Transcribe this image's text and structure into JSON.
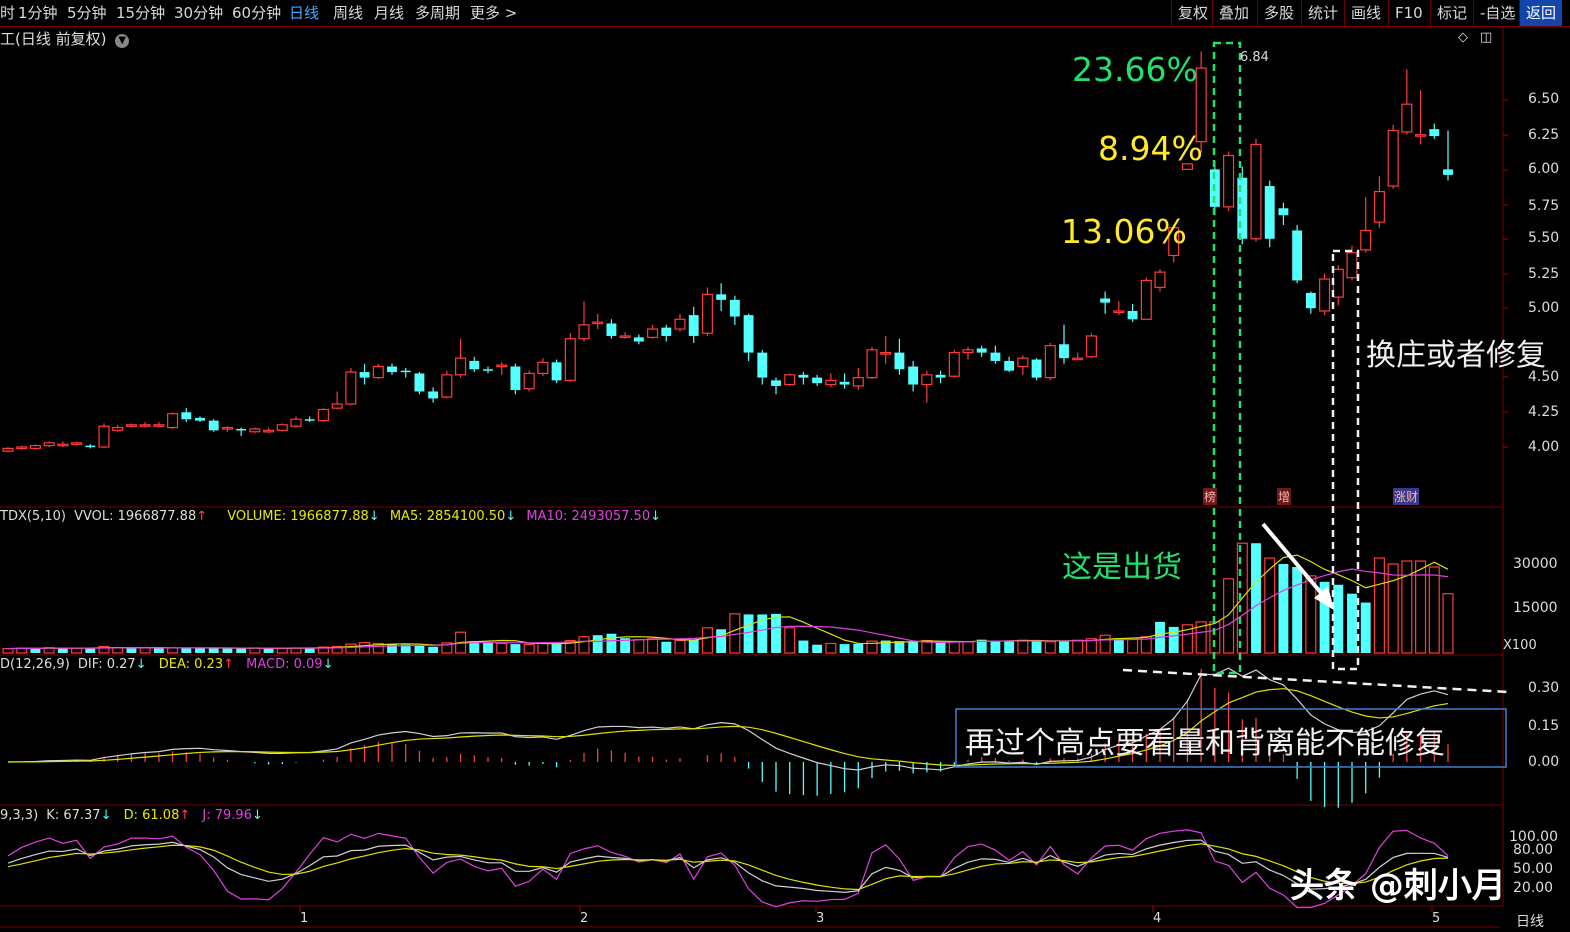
{
  "topbar": {
    "periods": [
      "1分钟",
      "5分钟",
      "15分钟",
      "30分钟",
      "60分钟",
      "日线",
      "周线",
      "月线",
      "多周期",
      "更多 >"
    ],
    "active_period": "日线",
    "tools": [
      "复权",
      "叠加",
      "多股",
      "统计",
      "画线",
      "F10",
      "标记",
      "-自选",
      "返回"
    ]
  },
  "price_panel": {
    "title": "(日线 前复权)",
    "high_label": "6.84",
    "y_ticks": [
      "6.50",
      "6.25",
      "6.00",
      "5.75",
      "5.50",
      "5.25",
      "5.00",
      "4.50",
      "4.25",
      "4.00"
    ],
    "markers": [
      "榜",
      "增",
      "涨财"
    ]
  },
  "volume_panel": {
    "legend": {
      "name": "TDX(5,10)",
      "vvol": "VVOL: 1966877.88",
      "volume": "VOLUME: 1966877.88",
      "ma5": "MA5: 2854100.50",
      "ma10": "MA10: 2493057.50"
    },
    "y_ticks": [
      "30000",
      "15000"
    ],
    "unit": "X100"
  },
  "macd_panel": {
    "legend": {
      "name": "D(12,26,9)",
      "dif": "DIF: 0.27",
      "dea": "DEA: 0.23",
      "macd": "MACD: 0.09"
    },
    "y_ticks": [
      "0.30",
      "0.15",
      "0.00"
    ]
  },
  "kdj_panel": {
    "legend": {
      "name": "9,3,3)",
      "k": "K: 67.37",
      "d": "D: 61.08",
      "j": "J: 79.96"
    },
    "y_ticks": [
      "100.00",
      "80.00",
      "50.00",
      "20.00"
    ]
  },
  "x_axis": {
    "labels": [
      "1",
      "2",
      "3",
      "4",
      "5"
    ],
    "period_label": "日线"
  },
  "annotations": {
    "pct1": "23.66%",
    "pct2": "8.94%",
    "pct3": "13.06%",
    "right_note": "换庄或者修复",
    "volume_note": "这是出货",
    "macd_note": "再过个高点要看量和背离能不能修复",
    "watermark": "头条 @刺小月"
  },
  "colors": {
    "up": "#ff3b3b",
    "down": "#54ffff",
    "ma5": "#e0e000",
    "ma10": "#e040e0",
    "dif": "#d0d0d0",
    "dea": "#e0e000",
    "green_annot": "#22e06b",
    "yellow_annot": "#ffe82a"
  },
  "chart_data": {
    "type": "candlestick",
    "y_range": [
      3.8,
      6.95
    ],
    "candles": [
      [
        3.97,
        3.99,
        3.96,
        4.0
      ],
      [
        3.99,
        4.0,
        3.98,
        4.01
      ],
      [
        3.99,
        4.01,
        3.98,
        4.02
      ],
      [
        4.01,
        4.03,
        4.0,
        4.04
      ],
      [
        4.01,
        4.02,
        4.0,
        4.04
      ],
      [
        4.02,
        4.03,
        4.01,
        4.04
      ],
      [
        4.01,
        4.0,
        3.99,
        4.02
      ],
      [
        4.0,
        4.15,
        3.99,
        4.17
      ],
      [
        4.12,
        4.14,
        4.11,
        4.16
      ],
      [
        4.15,
        4.16,
        4.14,
        4.17
      ],
      [
        4.16,
        4.16,
        4.14,
        4.18
      ],
      [
        4.15,
        4.16,
        4.14,
        4.18
      ],
      [
        4.14,
        4.24,
        4.13,
        4.25
      ],
      [
        4.25,
        4.2,
        4.18,
        4.28
      ],
      [
        4.21,
        4.19,
        4.18,
        4.22
      ],
      [
        4.19,
        4.12,
        4.11,
        4.2
      ],
      [
        4.13,
        4.14,
        4.11,
        4.15
      ],
      [
        4.13,
        4.12,
        4.08,
        4.14
      ],
      [
        4.11,
        4.13,
        4.1,
        4.14
      ],
      [
        4.12,
        4.12,
        4.1,
        4.14
      ],
      [
        4.12,
        4.16,
        4.11,
        4.17
      ],
      [
        4.15,
        4.2,
        4.14,
        4.22
      ],
      [
        4.2,
        4.19,
        4.18,
        4.22
      ],
      [
        4.19,
        4.27,
        4.18,
        4.28
      ],
      [
        4.28,
        4.31,
        4.27,
        4.4
      ],
      [
        4.31,
        4.54,
        4.3,
        4.57
      ],
      [
        4.54,
        4.5,
        4.45,
        4.6
      ],
      [
        4.5,
        4.58,
        4.49,
        4.6
      ],
      [
        4.58,
        4.54,
        4.52,
        4.6
      ],
      [
        4.55,
        4.54,
        4.5,
        4.57
      ],
      [
        4.53,
        4.4,
        4.38,
        4.54
      ],
      [
        4.4,
        4.35,
        4.32,
        4.43
      ],
      [
        4.36,
        4.52,
        4.35,
        4.55
      ],
      [
        4.52,
        4.64,
        4.5,
        4.78
      ],
      [
        4.62,
        4.56,
        4.54,
        4.65
      ],
      [
        4.56,
        4.55,
        4.53,
        4.58
      ],
      [
        4.58,
        4.59,
        4.52,
        4.61
      ],
      [
        4.58,
        4.41,
        4.38,
        4.6
      ],
      [
        4.42,
        4.53,
        4.4,
        4.55
      ],
      [
        4.53,
        4.61,
        4.51,
        4.64
      ],
      [
        4.61,
        4.48,
        4.46,
        4.63
      ],
      [
        4.48,
        4.78,
        4.47,
        4.82
      ],
      [
        4.78,
        4.88,
        4.76,
        5.05
      ],
      [
        4.9,
        4.9,
        4.85,
        4.96
      ],
      [
        4.89,
        4.8,
        4.78,
        4.92
      ],
      [
        4.8,
        4.8,
        4.78,
        4.83
      ],
      [
        4.79,
        4.76,
        4.74,
        4.81
      ],
      [
        4.79,
        4.85,
        4.78,
        4.88
      ],
      [
        4.86,
        4.8,
        4.76,
        4.88
      ],
      [
        4.85,
        4.92,
        4.83,
        4.96
      ],
      [
        4.95,
        4.8,
        4.75,
        5.01
      ],
      [
        4.82,
        5.1,
        4.8,
        5.15
      ],
      [
        5.1,
        5.06,
        4.98,
        5.18
      ],
      [
        5.06,
        4.94,
        4.88,
        5.09
      ],
      [
        4.95,
        4.68,
        4.62,
        4.96
      ],
      [
        4.68,
        4.5,
        4.45,
        4.7
      ],
      [
        4.48,
        4.44,
        4.38,
        4.5
      ],
      [
        4.45,
        4.52,
        4.44,
        4.53
      ],
      [
        4.52,
        4.5,
        4.45,
        4.54
      ],
      [
        4.5,
        4.46,
        4.44,
        4.52
      ],
      [
        4.45,
        4.48,
        4.43,
        4.53
      ],
      [
        4.47,
        4.45,
        4.42,
        4.53
      ],
      [
        4.44,
        4.5,
        4.41,
        4.57
      ],
      [
        4.5,
        4.7,
        4.49,
        4.72
      ],
      [
        4.68,
        4.68,
        4.6,
        4.8
      ],
      [
        4.68,
        4.56,
        4.52,
        4.78
      ],
      [
        4.58,
        4.45,
        4.4,
        4.62
      ],
      [
        4.45,
        4.52,
        4.32,
        4.55
      ],
      [
        4.52,
        4.5,
        4.46,
        4.55
      ],
      [
        4.51,
        4.68,
        4.5,
        4.7
      ],
      [
        4.68,
        4.7,
        4.63,
        4.72
      ],
      [
        4.71,
        4.68,
        4.65,
        4.73
      ],
      [
        4.68,
        4.62,
        4.6,
        4.73
      ],
      [
        4.62,
        4.55,
        4.54,
        4.65
      ],
      [
        4.58,
        4.64,
        4.52,
        4.66
      ],
      [
        4.63,
        4.5,
        4.48,
        4.64
      ],
      [
        4.5,
        4.73,
        4.48,
        4.75
      ],
      [
        4.74,
        4.64,
        4.6,
        4.88
      ],
      [
        4.64,
        4.64,
        4.63,
        4.68
      ],
      [
        4.65,
        4.8,
        4.64,
        4.82
      ],
      [
        5.07,
        5.04,
        4.96,
        5.12
      ],
      [
        4.98,
        4.98,
        4.95,
        5.05
      ],
      [
        4.98,
        4.92,
        4.9,
        5.03
      ],
      [
        4.92,
        5.2,
        4.92,
        5.22
      ],
      [
        5.15,
        5.26,
        5.12,
        5.28
      ],
      [
        5.38,
        5.58,
        5.33,
        5.6
      ],
      [
        6.0,
        6.04,
        6.0,
        6.04
      ],
      [
        6.2,
        6.73,
        6.12,
        6.85
      ],
      [
        6.0,
        5.73,
        5.67,
        6.06
      ],
      [
        5.73,
        6.1,
        5.7,
        6.13
      ],
      [
        5.94,
        5.5,
        5.46,
        6.02
      ],
      [
        5.5,
        6.18,
        5.48,
        6.22
      ],
      [
        5.88,
        5.5,
        5.44,
        5.92
      ],
      [
        5.72,
        5.67,
        5.6,
        5.76
      ],
      [
        5.56,
        5.2,
        5.18,
        5.6
      ],
      [
        5.11,
        5.0,
        4.96,
        5.12
      ],
      [
        4.98,
        5.21,
        4.95,
        5.25
      ],
      [
        5.08,
        5.28,
        5.02,
        5.31
      ],
      [
        5.22,
        5.4,
        5.2,
        5.45
      ],
      [
        5.42,
        5.56,
        5.4,
        5.8
      ],
      [
        5.62,
        5.84,
        5.58,
        5.95
      ],
      [
        5.88,
        6.28,
        5.86,
        6.32
      ],
      [
        6.27,
        6.47,
        6.25,
        6.72
      ],
      [
        6.25,
        6.25,
        6.18,
        6.57
      ],
      [
        6.29,
        6.24,
        6.22,
        6.33
      ],
      [
        6.0,
        5.96,
        5.92,
        6.28
      ]
    ],
    "volume": [
      [
        1500,
        1
      ],
      [
        1600,
        1
      ],
      [
        1600,
        0
      ],
      [
        1800,
        1
      ],
      [
        1700,
        0
      ],
      [
        1600,
        1
      ],
      [
        1500,
        0
      ],
      [
        2200,
        1
      ],
      [
        1800,
        1
      ],
      [
        1700,
        0
      ],
      [
        1700,
        1
      ],
      [
        1600,
        0
      ],
      [
        1700,
        1
      ],
      [
        1800,
        0
      ],
      [
        1700,
        0
      ],
      [
        1600,
        0
      ],
      [
        1500,
        0
      ],
      [
        1600,
        0
      ],
      [
        1700,
        1
      ],
      [
        1600,
        0
      ],
      [
        1600,
        1
      ],
      [
        1700,
        1
      ],
      [
        1800,
        0
      ],
      [
        2000,
        1
      ],
      [
        2200,
        1
      ],
      [
        3000,
        1
      ],
      [
        3500,
        1
      ],
      [
        3200,
        1
      ],
      [
        3000,
        0
      ],
      [
        2800,
        0
      ],
      [
        2400,
        0
      ],
      [
        2100,
        0
      ],
      [
        3400,
        1
      ],
      [
        7000,
        1
      ],
      [
        4000,
        0
      ],
      [
        3500,
        0
      ],
      [
        3200,
        1
      ],
      [
        3000,
        0
      ],
      [
        2900,
        1
      ],
      [
        3300,
        1
      ],
      [
        3200,
        0
      ],
      [
        4200,
        1
      ],
      [
        5500,
        1
      ],
      [
        6000,
        0
      ],
      [
        6500,
        0
      ],
      [
        5000,
        0
      ],
      [
        4500,
        1
      ],
      [
        4800,
        1
      ],
      [
        3800,
        0
      ],
      [
        4200,
        1
      ],
      [
        4400,
        0
      ],
      [
        8500,
        1
      ],
      [
        8000,
        0
      ],
      [
        13200,
        1
      ],
      [
        13000,
        0
      ],
      [
        13000,
        0
      ],
      [
        13200,
        0
      ],
      [
        8500,
        1
      ],
      [
        4200,
        0
      ],
      [
        2800,
        0
      ],
      [
        3200,
        1
      ],
      [
        3000,
        0
      ],
      [
        3100,
        0
      ],
      [
        4000,
        1
      ],
      [
        4200,
        0
      ],
      [
        4000,
        0
      ],
      [
        3800,
        0
      ],
      [
        4200,
        1
      ],
      [
        3600,
        0
      ],
      [
        3800,
        1
      ],
      [
        3800,
        1
      ],
      [
        4500,
        0
      ],
      [
        4200,
        0
      ],
      [
        4200,
        0
      ],
      [
        4300,
        1
      ],
      [
        3900,
        0
      ],
      [
        3800,
        1
      ],
      [
        4200,
        0
      ],
      [
        4300,
        1
      ],
      [
        4800,
        1
      ],
      [
        6000,
        1
      ],
      [
        5000,
        0
      ],
      [
        5000,
        1
      ],
      [
        5500,
        1
      ],
      [
        10500,
        0
      ],
      [
        8800,
        0
      ],
      [
        9500,
        1
      ],
      [
        10500,
        1
      ],
      [
        10500,
        1
      ],
      [
        25000,
        1
      ],
      [
        37000,
        1
      ],
      [
        37000,
        0
      ],
      [
        32000,
        1
      ],
      [
        30000,
        0
      ],
      [
        29000,
        0
      ],
      [
        26000,
        1
      ],
      [
        24000,
        0
      ],
      [
        23000,
        0
      ],
      [
        20000,
        0
      ],
      [
        17000,
        0
      ],
      [
        32000,
        1
      ],
      [
        30000,
        1
      ],
      [
        31000,
        1
      ],
      [
        31000,
        1
      ],
      [
        29000,
        1
      ],
      [
        20000,
        1
      ]
    ],
    "x_labels": [
      "1",
      "2",
      "3",
      "4",
      "5"
    ]
  }
}
